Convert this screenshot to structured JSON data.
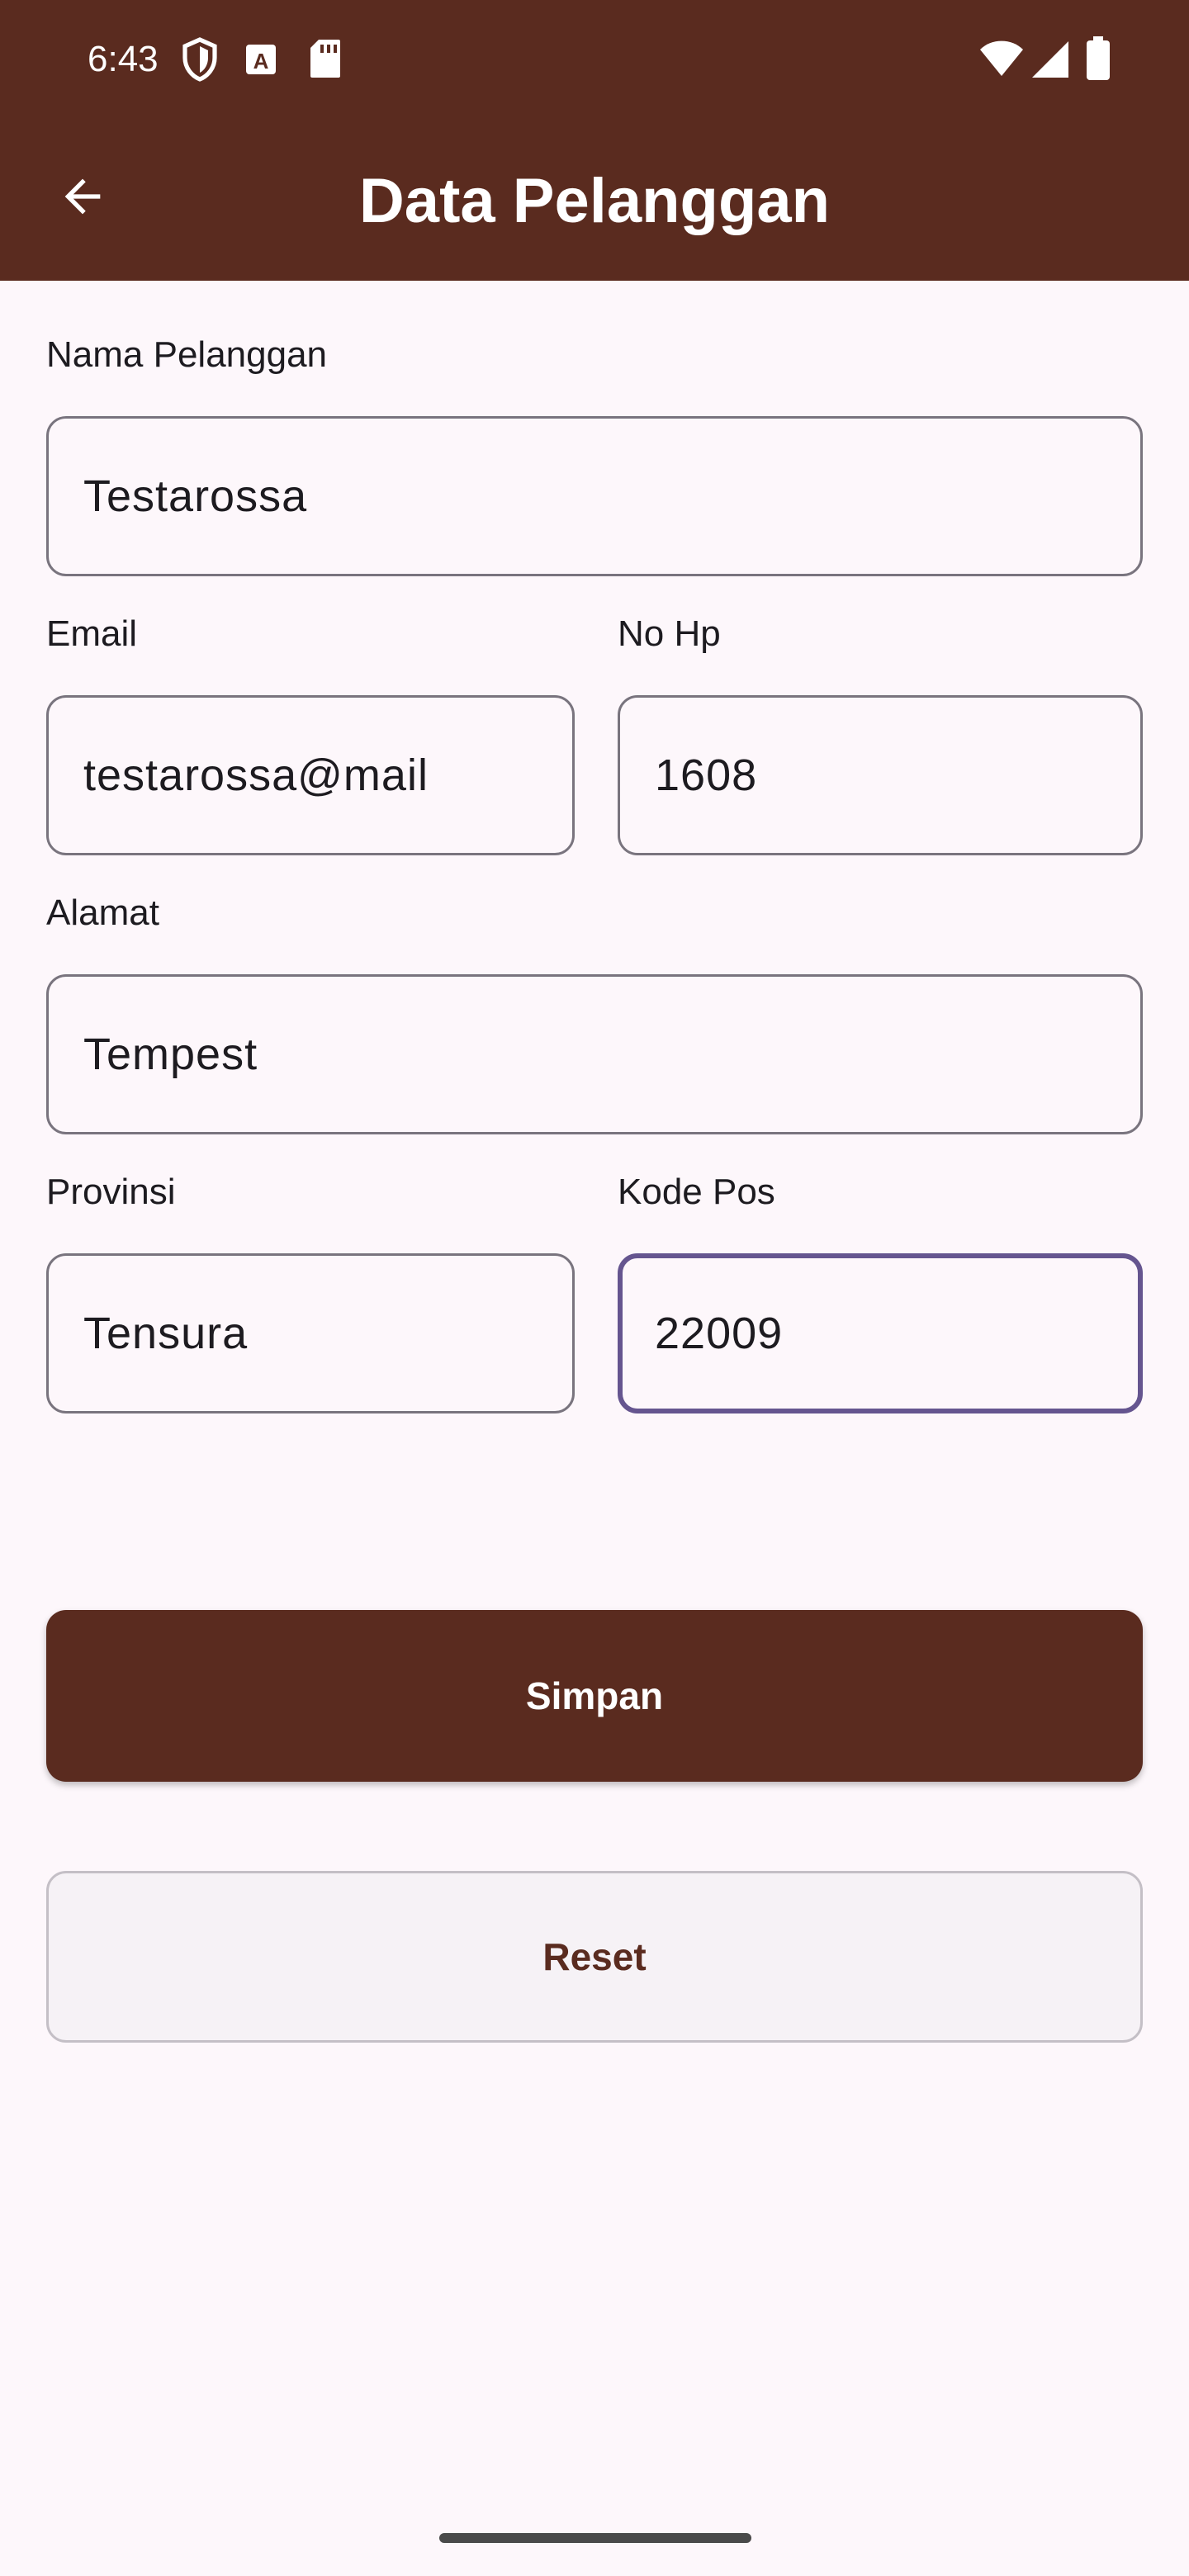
{
  "status_bar": {
    "time": "6:43",
    "left_icons": [
      "shield-icon",
      "font-a-icon",
      "sd-card-icon"
    ],
    "right_icons": [
      "wifi-icon",
      "cell-signal-icon",
      "battery-icon"
    ]
  },
  "appbar": {
    "title": "Data Pelanggan",
    "back_icon": "arrow-back-icon",
    "color": "#5a2b1f"
  },
  "form": {
    "nama": {
      "label": "Nama Pelanggan",
      "value": "Testarossa"
    },
    "email": {
      "label": "Email",
      "value": "testarossa@mail"
    },
    "no_hp": {
      "label": "No Hp",
      "value": "1608"
    },
    "alamat": {
      "label": "Alamat",
      "value": "Tempest"
    },
    "provinsi": {
      "label": "Provinsi",
      "value": "Tensura"
    },
    "kode_pos": {
      "label": "Kode Pos",
      "value": "22009",
      "focused": true
    }
  },
  "buttons": {
    "save_label": "Simpan",
    "reset_label": "Reset"
  },
  "colors": {
    "primary": "#5a2b1f",
    "background": "#fdf7fb",
    "focus_border": "#65558f",
    "outline": "#79747e"
  }
}
